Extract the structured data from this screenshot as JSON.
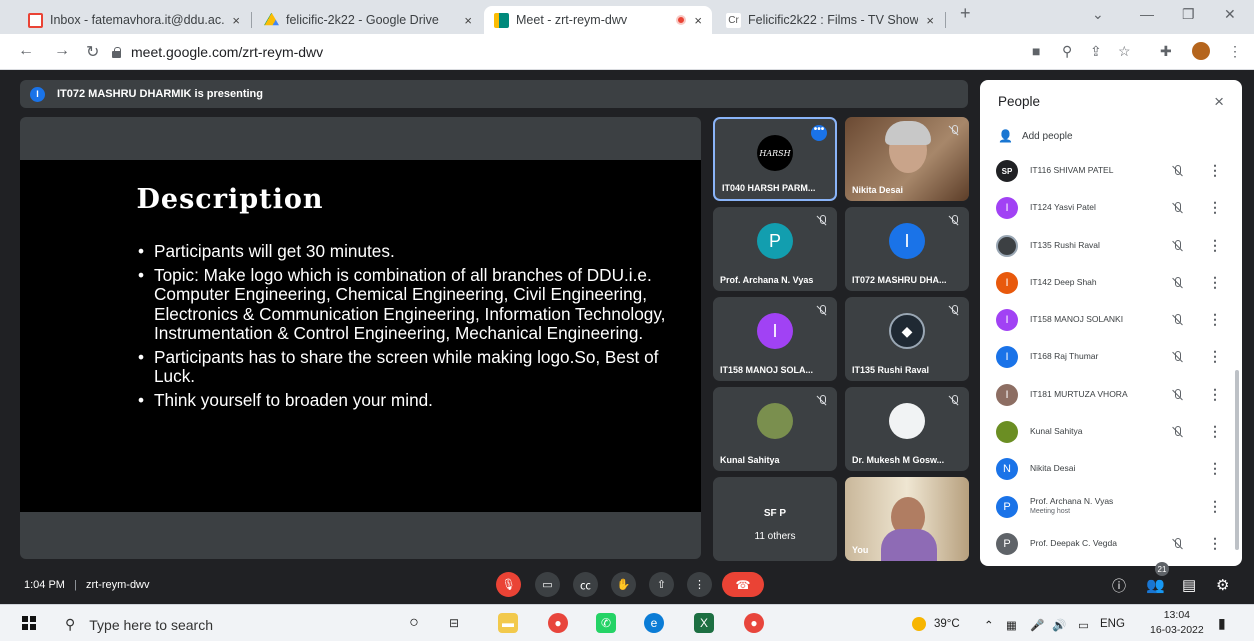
{
  "browser": {
    "tabs": [
      {
        "title": "Inbox - fatemavhora.it@ddu.ac.in",
        "close": "×"
      },
      {
        "title": "felicific-2k22 - Google Drive",
        "close": "×"
      },
      {
        "title": "Meet - zrt-reym-dwv",
        "close": "×"
      },
      {
        "title": "Felicific2k22 : Films - TV Show",
        "close": "×"
      }
    ],
    "new_tab": "+",
    "url": "meet.google.com/zrt-reym-dwv"
  },
  "meet": {
    "banner": {
      "avatar_letter": "I",
      "text": "IT072 MASHRU DHARMIK is presenting"
    },
    "slide": {
      "title": "Description",
      "bullets": [
        "Participants will get 30 minutes.",
        "Topic: Make logo which is combination of all branches of DDU.i.e. Computer Engineering, Chemical Engineering, Civil Engineering, Electronics & Communication Engineering, Information Technology, Instrumentation & Control Engineering, Mechanical Engineering.",
        "Participants has to share the screen while making logo.So, Best of Luck.",
        "Think yourself to broaden your mind."
      ]
    },
    "tiles": [
      {
        "name": "IT040 HARSH PARM...",
        "logo_text": "HARSH"
      },
      {
        "name": "Nikita Desai"
      },
      {
        "name": "Prof. Archana N. Vyas",
        "letter": "P"
      },
      {
        "name": "IT072 MASHRU DHA...",
        "letter": "I"
      },
      {
        "name": "IT158 MANOJ SOLA...",
        "letter": "I"
      },
      {
        "name": "IT135 Rushi Raval"
      },
      {
        "name": "Kunal Sahitya"
      },
      {
        "name": "Dr. Mukesh M Gosw..."
      },
      {
        "name": "11 others",
        "letters": "SF P"
      },
      {
        "name": "You"
      }
    ],
    "more_options": "•••",
    "people": {
      "title": "People",
      "close": "×",
      "add_people": "Add people",
      "list": [
        {
          "name": "IT116 SHIVAM PATEL",
          "avatar": "SP",
          "color": "#202124"
        },
        {
          "name": "IT124 Yasvi Patel",
          "avatar": "I",
          "color": "#a142f4"
        },
        {
          "name": "IT135 Rushi Raval",
          "avatar": "",
          "color": "#3c4043"
        },
        {
          "name": "IT142 Deep Shah",
          "avatar": "I",
          "color": "#e8590c"
        },
        {
          "name": "IT158 MANOJ SOLANKI",
          "avatar": "I",
          "color": "#a142f4"
        },
        {
          "name": "IT168 Raj Thumar",
          "avatar": "I",
          "color": "#1a73e8"
        },
        {
          "name": "IT181 MURTUZA VHORA",
          "avatar": "I",
          "color": "#8d6e63"
        },
        {
          "name": "Kunal Sahitya",
          "avatar": "",
          "color": "#6b8e23"
        },
        {
          "name": "Nikita Desai",
          "avatar": "N",
          "color": "#1a73e8"
        },
        {
          "name": "Prof. Archana N. Vyas",
          "avatar": "P",
          "color": "#1a73e8",
          "sub": "Meeting host"
        },
        {
          "name": "Prof. Deepak C. Vegda",
          "avatar": "P",
          "color": "#5f6368"
        }
      ]
    },
    "controls": {
      "time": "1:04 PM",
      "separator": "|",
      "meeting_code": "zrt-reym-dwv",
      "people_count": "21"
    }
  },
  "taskbar": {
    "search_placeholder": "Type here to search",
    "temperature": "39°C",
    "language": "ENG",
    "time": "13:04",
    "date": "16-03-2022"
  }
}
